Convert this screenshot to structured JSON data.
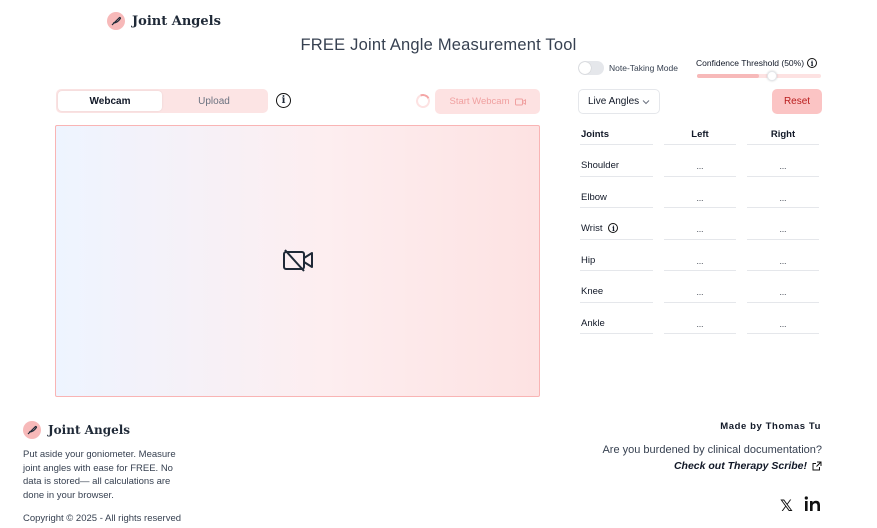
{
  "brand": {
    "name": "Joint Angels",
    "accent": "#f7b9b9"
  },
  "title": "FREE Joint Angle Measurement Tool",
  "note_mode": {
    "label": "Note-Taking Mode",
    "enabled": false
  },
  "threshold": {
    "label": "Confidence Threshold (50%)",
    "value_fraction": 0.5
  },
  "source_tabs": [
    {
      "label": "Webcam",
      "active": true
    },
    {
      "label": "Upload",
      "active": false
    }
  ],
  "start_webcam": {
    "label": "Start Webcam"
  },
  "angles_select": {
    "value": "Live Angles"
  },
  "reset_label": "Reset",
  "table": {
    "headers": [
      "Joints",
      "Left",
      "Right"
    ],
    "rows": [
      {
        "joint": "Shoulder",
        "left": "...",
        "right": "..."
      },
      {
        "joint": "Elbow",
        "left": "...",
        "right": "..."
      },
      {
        "joint": "Wrist",
        "left": "...",
        "right": "..."
      },
      {
        "joint": "Hip",
        "left": "...",
        "right": "..."
      },
      {
        "joint": "Knee",
        "left": "...",
        "right": "..."
      },
      {
        "joint": "Ankle",
        "left": "...",
        "right": "..."
      }
    ]
  },
  "footer": {
    "brand": "Joint Angels",
    "description": "Put aside your goniometer. Measure joint angles with ease for FREE. No data is stored— all calculations are done in your browser.",
    "copyright": "Copyright © 2025 - All rights reserved",
    "made_by": "Made by Thomas Tu",
    "burden": "Are you burdened by clinical documentation?",
    "scribe_link": "Check out Therapy Scribe!"
  }
}
